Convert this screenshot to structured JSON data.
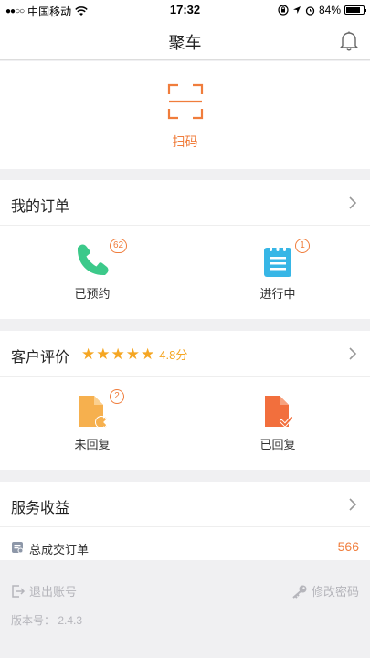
{
  "status_bar": {
    "signal_dots": "●●○○",
    "carrier": "中国移动",
    "time": "17:32",
    "battery_text": "84%",
    "battery_level": 0.84
  },
  "nav": {
    "title": "聚车",
    "bell_icon": "bell-icon"
  },
  "scan": {
    "label": "扫码",
    "icon": "scan-icon"
  },
  "orders": {
    "title": "我的订单",
    "booked": {
      "label": "已预约",
      "badge": "62",
      "icon": "phone-icon"
    },
    "in_progress": {
      "label": "进行中",
      "badge": "1",
      "icon": "notepad-icon"
    }
  },
  "reviews": {
    "title": "客户评价",
    "stars": 5,
    "rating": "4.8分",
    "unreplied": {
      "label": "未回复",
      "badge": "2",
      "icon": "file-x-icon"
    },
    "replied": {
      "label": "已回复",
      "icon": "file-check-icon"
    }
  },
  "income": {
    "title": "服务收益",
    "total_label": "总成交订单",
    "total_value": "566"
  },
  "footer": {
    "logout": "退出账号",
    "change_password": "修改密码",
    "version": "版本号： 2.4.3"
  },
  "colors": {
    "accent": "#f07d3c",
    "star": "#f5a623",
    "phone": "#3cc98a",
    "notepad": "#37b6e6",
    "file_unreplied": "#f6b04e",
    "file_replied": "#f26f3d"
  }
}
